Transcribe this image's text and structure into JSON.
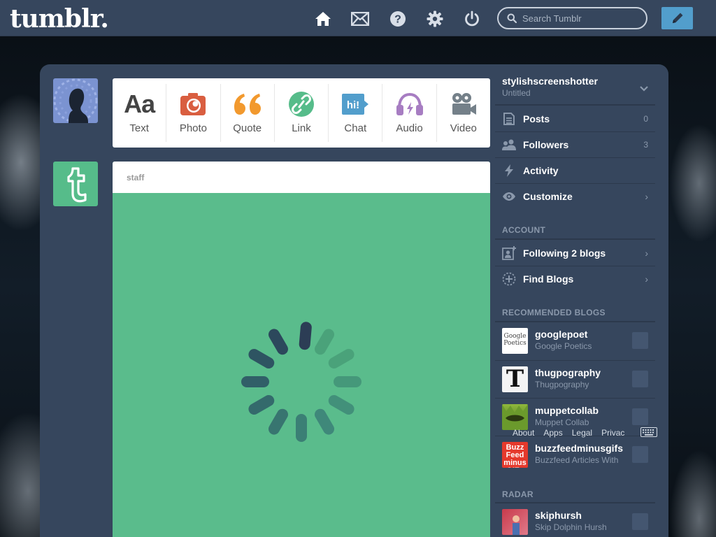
{
  "header": {
    "logo": "tumblr.",
    "search_placeholder": "Search Tumblr"
  },
  "post_types": [
    {
      "label": "Text"
    },
    {
      "label": "Photo"
    },
    {
      "label": "Quote"
    },
    {
      "label": "Link"
    },
    {
      "label": "Chat"
    },
    {
      "label": "Audio"
    },
    {
      "label": "Video"
    }
  ],
  "post": {
    "author": "staff"
  },
  "sidebar": {
    "blog_name": "stylishscreenshotter",
    "blog_title": "Untitled",
    "items": [
      {
        "label": "Posts",
        "count": "0"
      },
      {
        "label": "Followers",
        "count": "3"
      },
      {
        "label": "Activity"
      },
      {
        "label": "Customize"
      }
    ],
    "account_heading": "ACCOUNT",
    "account_items": [
      {
        "label": "Following 2 blogs"
      },
      {
        "label": "Find Blogs"
      }
    ],
    "recommended_heading": "RECOMMENDED BLOGS",
    "recommended": [
      {
        "name": "googlepoet",
        "title": "Google Poetics",
        "avatar_text": "Google Poetics"
      },
      {
        "name": "thugpography",
        "title": "Thugpography",
        "avatar_text": "T"
      },
      {
        "name": "muppetcollab",
        "title": "Muppet Collab",
        "avatar_text": ""
      },
      {
        "name": "buzzfeedminusgifs",
        "title": "Buzzfeed Articles With",
        "avatar_text": "Buzz Feed minus GIFs"
      }
    ],
    "radar_heading": "RADAR",
    "radar": [
      {
        "name": "skiphursh",
        "title": "Skip Dolphin Hursh"
      }
    ]
  },
  "footer": {
    "links": [
      "About",
      "Apps",
      "Legal",
      "Privac"
    ]
  },
  "colors": {
    "topbar": "#36465d",
    "dashboard": "#36465d",
    "post_bg": "#5abc8c",
    "compose": "#529ecc",
    "text_icon": "#444444",
    "photo_icon": "#d95e40",
    "quote_icon": "#f2992e",
    "link_icon": "#56bc8a",
    "chat_icon": "#529ecc",
    "audio_icon": "#a77dc2",
    "video_icon": "#748089"
  }
}
